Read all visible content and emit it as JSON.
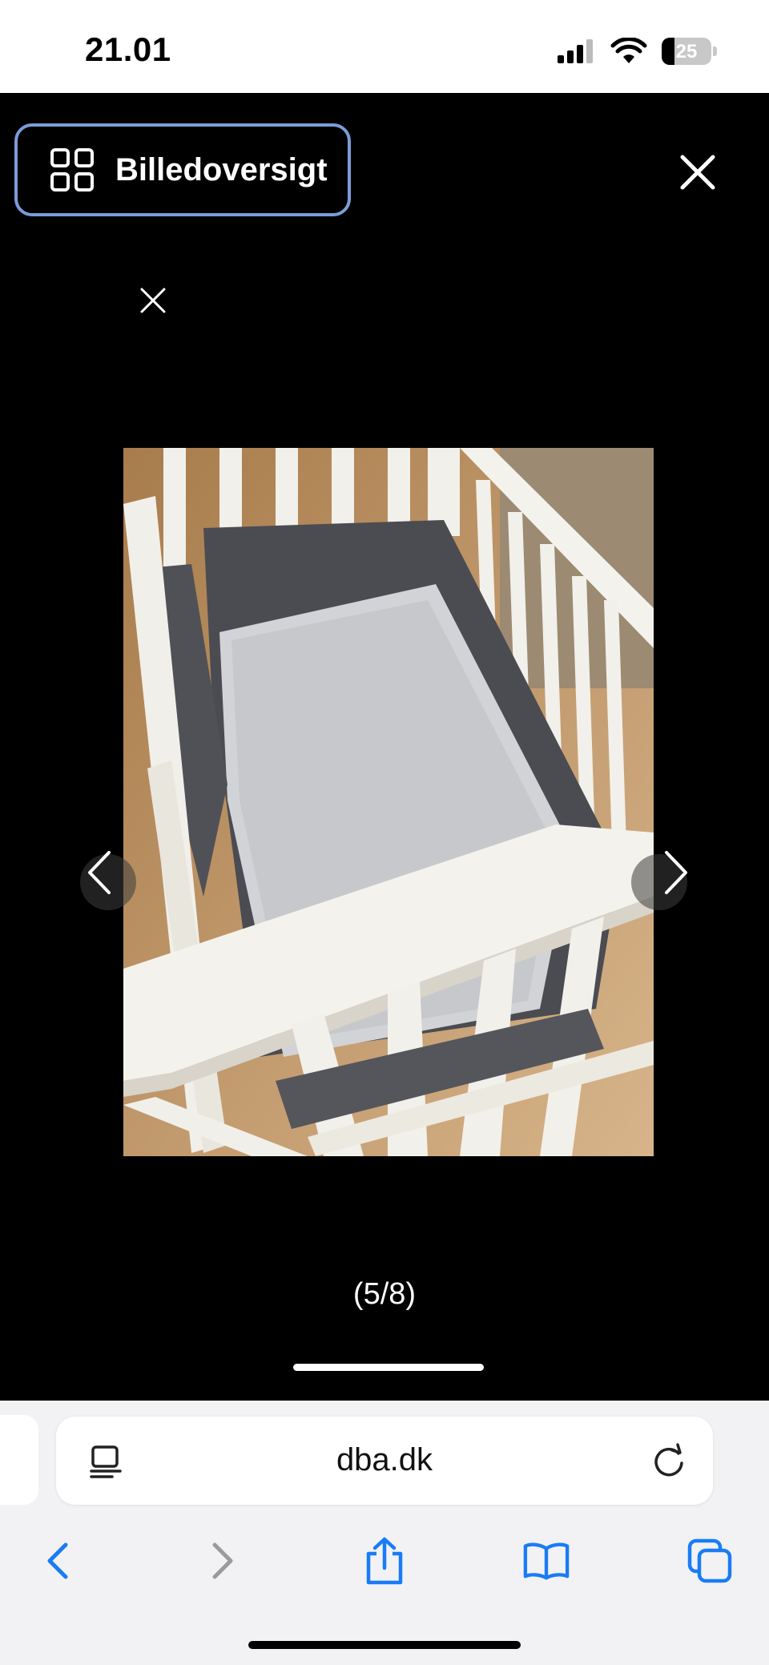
{
  "status_bar": {
    "time": "21.01",
    "battery_level": "25"
  },
  "viewer": {
    "overview_button_label": "Billedoversigt",
    "counter": "(5/8)",
    "icons": [
      "grid-icon",
      "close-icon",
      "close-small-icon",
      "chevron-left-icon",
      "chevron-right-icon"
    ],
    "photo_description_icon": "crib-photo"
  },
  "browser": {
    "url": "dba.dk",
    "icons": [
      "reader-icon",
      "reload-icon",
      "back-icon",
      "forward-icon",
      "share-icon",
      "bookmarks-icon",
      "tabs-icon"
    ]
  },
  "colors": {
    "accent_blue": "#1a7cf5",
    "focus_ring": "#7b9cd8"
  }
}
